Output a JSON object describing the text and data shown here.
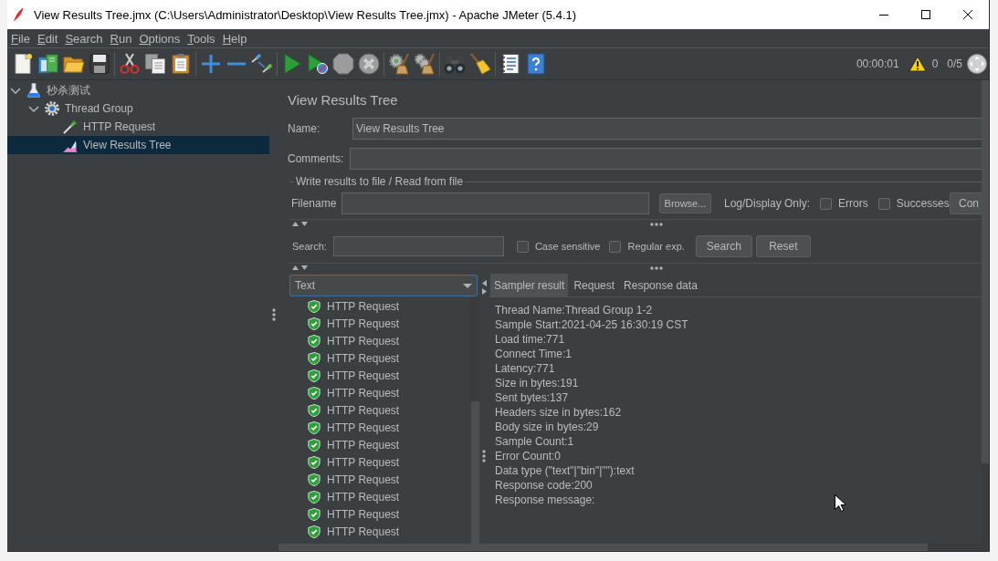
{
  "window": {
    "title": "View Results Tree.jmx (C:\\Users\\Administrator\\Desktop\\View Results Tree.jmx) - Apache JMeter (5.4.1)"
  },
  "menu": [
    "File",
    "Edit",
    "Search",
    "Run",
    "Options",
    "Tools",
    "Help"
  ],
  "toolbar": {
    "groups": [
      {
        "buttons": [
          {
            "kind": "new",
            "disabled": false
          },
          {
            "kind": "templates",
            "disabled": false
          },
          {
            "kind": "open",
            "disabled": false
          },
          {
            "kind": "save",
            "disabled": false
          }
        ]
      },
      {
        "buttons": [
          {
            "kind": "cut",
            "disabled": false
          },
          {
            "kind": "copy",
            "disabled": false
          },
          {
            "kind": "paste",
            "disabled": false
          }
        ]
      },
      {
        "buttons": [
          {
            "kind": "expand",
            "disabled": false
          },
          {
            "kind": "collapse",
            "disabled": false
          },
          {
            "kind": "toggle",
            "disabled": false
          }
        ]
      },
      {
        "buttons": [
          {
            "kind": "start",
            "disabled": false
          },
          {
            "kind": "start_no_pauses",
            "disabled": false
          },
          {
            "kind": "stop",
            "disabled": true
          },
          {
            "kind": "shutdown",
            "disabled": true
          }
        ]
      },
      {
        "buttons": [
          {
            "kind": "clear",
            "disabled": false
          },
          {
            "kind": "clear_all",
            "disabled": false
          }
        ]
      },
      {
        "buttons": [
          {
            "kind": "search",
            "disabled": false
          },
          {
            "kind": "reset_search",
            "disabled": false
          }
        ]
      },
      {
        "buttons": [
          {
            "kind": "functions",
            "disabled": false
          },
          {
            "kind": "help",
            "disabled": false
          }
        ]
      }
    ],
    "elapsed": "00:00:01",
    "warnings": "0",
    "threads": "0/5"
  },
  "tree": [
    {
      "label": "秒杀测试",
      "kind": "test_plan",
      "expanded": true,
      "selected": false,
      "children": [
        {
          "label": "Thread Group",
          "kind": "thread_group",
          "expanded": true,
          "selected": false,
          "children": [
            {
              "label": "HTTP Request",
              "kind": "sampler",
              "selected": false
            },
            {
              "label": "View Results Tree",
              "kind": "listener",
              "selected": true
            }
          ]
        }
      ]
    }
  ],
  "panel": {
    "title": "View Results Tree",
    "name": {
      "label": "Name:",
      "value": "View Results Tree"
    },
    "comments": {
      "label": "Comments:"
    },
    "file": {
      "title": "Write results to file / Read from file",
      "filename_label": "Filename",
      "browse": "Browse...",
      "log_label": "Log/Display Only:",
      "errors": {
        "label": "Errors",
        "checked": false
      },
      "successes": {
        "label": "Successes",
        "checked": false
      },
      "configure": "Con"
    },
    "search": {
      "label": "Search:",
      "case_sensitive": {
        "label": "Case sensitive",
        "checked": false
      },
      "regular_exp": {
        "label": "Regular exp.",
        "checked": false
      },
      "search_button": "Search",
      "reset_button": "Reset"
    }
  },
  "results": {
    "renderer": "Text",
    "samples": [
      {
        "label": "HTTP Request",
        "success": true
      },
      {
        "label": "HTTP Request",
        "success": true
      },
      {
        "label": "HTTP Request",
        "success": true
      },
      {
        "label": "HTTP Request",
        "success": true
      },
      {
        "label": "HTTP Request",
        "success": true
      },
      {
        "label": "HTTP Request",
        "success": true
      },
      {
        "label": "HTTP Request",
        "success": true
      },
      {
        "label": "HTTP Request",
        "success": true
      },
      {
        "label": "HTTP Request",
        "success": true
      },
      {
        "label": "HTTP Request",
        "success": true
      },
      {
        "label": "HTTP Request",
        "success": true
      },
      {
        "label": "HTTP Request",
        "success": true
      },
      {
        "label": "HTTP Request",
        "success": true
      },
      {
        "label": "HTTP Request",
        "success": true
      }
    ],
    "tabs": [
      {
        "label": "Sampler result",
        "selected": true
      },
      {
        "label": "Request",
        "selected": false
      },
      {
        "label": "Response data",
        "selected": false
      }
    ],
    "lines": [
      "Thread Name:Thread Group 1-2",
      "Sample Start:2021-04-25 16:30:19 CST",
      "Load time:771",
      "Connect Time:1",
      "Latency:771",
      "Size in bytes:191",
      "Sent bytes:137",
      "Headers size in bytes:162",
      "Body size in bytes:29",
      "Sample Count:1",
      "Error Count:0",
      "Data type (\"text\"|\"bin\"|\"\"):text",
      "Response code:200",
      "Response message:"
    ]
  }
}
